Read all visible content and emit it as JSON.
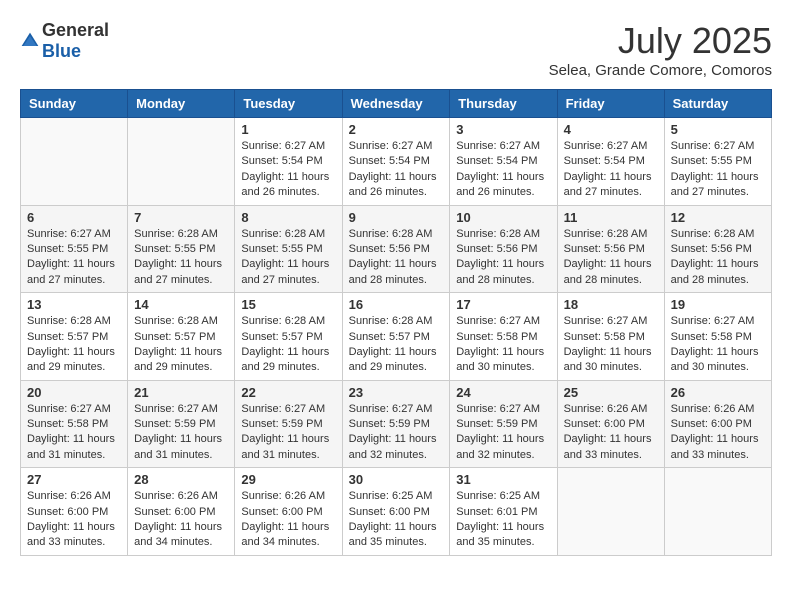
{
  "header": {
    "logo_general": "General",
    "logo_blue": "Blue",
    "month": "July 2025",
    "location": "Selea, Grande Comore, Comoros"
  },
  "weekdays": [
    "Sunday",
    "Monday",
    "Tuesday",
    "Wednesday",
    "Thursday",
    "Friday",
    "Saturday"
  ],
  "weeks": [
    [
      {
        "day": "",
        "sunrise": "",
        "sunset": "",
        "daylight": ""
      },
      {
        "day": "",
        "sunrise": "",
        "sunset": "",
        "daylight": ""
      },
      {
        "day": "1",
        "sunrise": "Sunrise: 6:27 AM",
        "sunset": "Sunset: 5:54 PM",
        "daylight": "Daylight: 11 hours and 26 minutes."
      },
      {
        "day": "2",
        "sunrise": "Sunrise: 6:27 AM",
        "sunset": "Sunset: 5:54 PM",
        "daylight": "Daylight: 11 hours and 26 minutes."
      },
      {
        "day": "3",
        "sunrise": "Sunrise: 6:27 AM",
        "sunset": "Sunset: 5:54 PM",
        "daylight": "Daylight: 11 hours and 26 minutes."
      },
      {
        "day": "4",
        "sunrise": "Sunrise: 6:27 AM",
        "sunset": "Sunset: 5:54 PM",
        "daylight": "Daylight: 11 hours and 27 minutes."
      },
      {
        "day": "5",
        "sunrise": "Sunrise: 6:27 AM",
        "sunset": "Sunset: 5:55 PM",
        "daylight": "Daylight: 11 hours and 27 minutes."
      }
    ],
    [
      {
        "day": "6",
        "sunrise": "Sunrise: 6:27 AM",
        "sunset": "Sunset: 5:55 PM",
        "daylight": "Daylight: 11 hours and 27 minutes."
      },
      {
        "day": "7",
        "sunrise": "Sunrise: 6:28 AM",
        "sunset": "Sunset: 5:55 PM",
        "daylight": "Daylight: 11 hours and 27 minutes."
      },
      {
        "day": "8",
        "sunrise": "Sunrise: 6:28 AM",
        "sunset": "Sunset: 5:55 PM",
        "daylight": "Daylight: 11 hours and 27 minutes."
      },
      {
        "day": "9",
        "sunrise": "Sunrise: 6:28 AM",
        "sunset": "Sunset: 5:56 PM",
        "daylight": "Daylight: 11 hours and 28 minutes."
      },
      {
        "day": "10",
        "sunrise": "Sunrise: 6:28 AM",
        "sunset": "Sunset: 5:56 PM",
        "daylight": "Daylight: 11 hours and 28 minutes."
      },
      {
        "day": "11",
        "sunrise": "Sunrise: 6:28 AM",
        "sunset": "Sunset: 5:56 PM",
        "daylight": "Daylight: 11 hours and 28 minutes."
      },
      {
        "day": "12",
        "sunrise": "Sunrise: 6:28 AM",
        "sunset": "Sunset: 5:56 PM",
        "daylight": "Daylight: 11 hours and 28 minutes."
      }
    ],
    [
      {
        "day": "13",
        "sunrise": "Sunrise: 6:28 AM",
        "sunset": "Sunset: 5:57 PM",
        "daylight": "Daylight: 11 hours and 29 minutes."
      },
      {
        "day": "14",
        "sunrise": "Sunrise: 6:28 AM",
        "sunset": "Sunset: 5:57 PM",
        "daylight": "Daylight: 11 hours and 29 minutes."
      },
      {
        "day": "15",
        "sunrise": "Sunrise: 6:28 AM",
        "sunset": "Sunset: 5:57 PM",
        "daylight": "Daylight: 11 hours and 29 minutes."
      },
      {
        "day": "16",
        "sunrise": "Sunrise: 6:28 AM",
        "sunset": "Sunset: 5:57 PM",
        "daylight": "Daylight: 11 hours and 29 minutes."
      },
      {
        "day": "17",
        "sunrise": "Sunrise: 6:27 AM",
        "sunset": "Sunset: 5:58 PM",
        "daylight": "Daylight: 11 hours and 30 minutes."
      },
      {
        "day": "18",
        "sunrise": "Sunrise: 6:27 AM",
        "sunset": "Sunset: 5:58 PM",
        "daylight": "Daylight: 11 hours and 30 minutes."
      },
      {
        "day": "19",
        "sunrise": "Sunrise: 6:27 AM",
        "sunset": "Sunset: 5:58 PM",
        "daylight": "Daylight: 11 hours and 30 minutes."
      }
    ],
    [
      {
        "day": "20",
        "sunrise": "Sunrise: 6:27 AM",
        "sunset": "Sunset: 5:58 PM",
        "daylight": "Daylight: 11 hours and 31 minutes."
      },
      {
        "day": "21",
        "sunrise": "Sunrise: 6:27 AM",
        "sunset": "Sunset: 5:59 PM",
        "daylight": "Daylight: 11 hours and 31 minutes."
      },
      {
        "day": "22",
        "sunrise": "Sunrise: 6:27 AM",
        "sunset": "Sunset: 5:59 PM",
        "daylight": "Daylight: 11 hours and 31 minutes."
      },
      {
        "day": "23",
        "sunrise": "Sunrise: 6:27 AM",
        "sunset": "Sunset: 5:59 PM",
        "daylight": "Daylight: 11 hours and 32 minutes."
      },
      {
        "day": "24",
        "sunrise": "Sunrise: 6:27 AM",
        "sunset": "Sunset: 5:59 PM",
        "daylight": "Daylight: 11 hours and 32 minutes."
      },
      {
        "day": "25",
        "sunrise": "Sunrise: 6:26 AM",
        "sunset": "Sunset: 6:00 PM",
        "daylight": "Daylight: 11 hours and 33 minutes."
      },
      {
        "day": "26",
        "sunrise": "Sunrise: 6:26 AM",
        "sunset": "Sunset: 6:00 PM",
        "daylight": "Daylight: 11 hours and 33 minutes."
      }
    ],
    [
      {
        "day": "27",
        "sunrise": "Sunrise: 6:26 AM",
        "sunset": "Sunset: 6:00 PM",
        "daylight": "Daylight: 11 hours and 33 minutes."
      },
      {
        "day": "28",
        "sunrise": "Sunrise: 6:26 AM",
        "sunset": "Sunset: 6:00 PM",
        "daylight": "Daylight: 11 hours and 34 minutes."
      },
      {
        "day": "29",
        "sunrise": "Sunrise: 6:26 AM",
        "sunset": "Sunset: 6:00 PM",
        "daylight": "Daylight: 11 hours and 34 minutes."
      },
      {
        "day": "30",
        "sunrise": "Sunrise: 6:25 AM",
        "sunset": "Sunset: 6:00 PM",
        "daylight": "Daylight: 11 hours and 35 minutes."
      },
      {
        "day": "31",
        "sunrise": "Sunrise: 6:25 AM",
        "sunset": "Sunset: 6:01 PM",
        "daylight": "Daylight: 11 hours and 35 minutes."
      },
      {
        "day": "",
        "sunrise": "",
        "sunset": "",
        "daylight": ""
      },
      {
        "day": "",
        "sunrise": "",
        "sunset": "",
        "daylight": ""
      }
    ]
  ]
}
